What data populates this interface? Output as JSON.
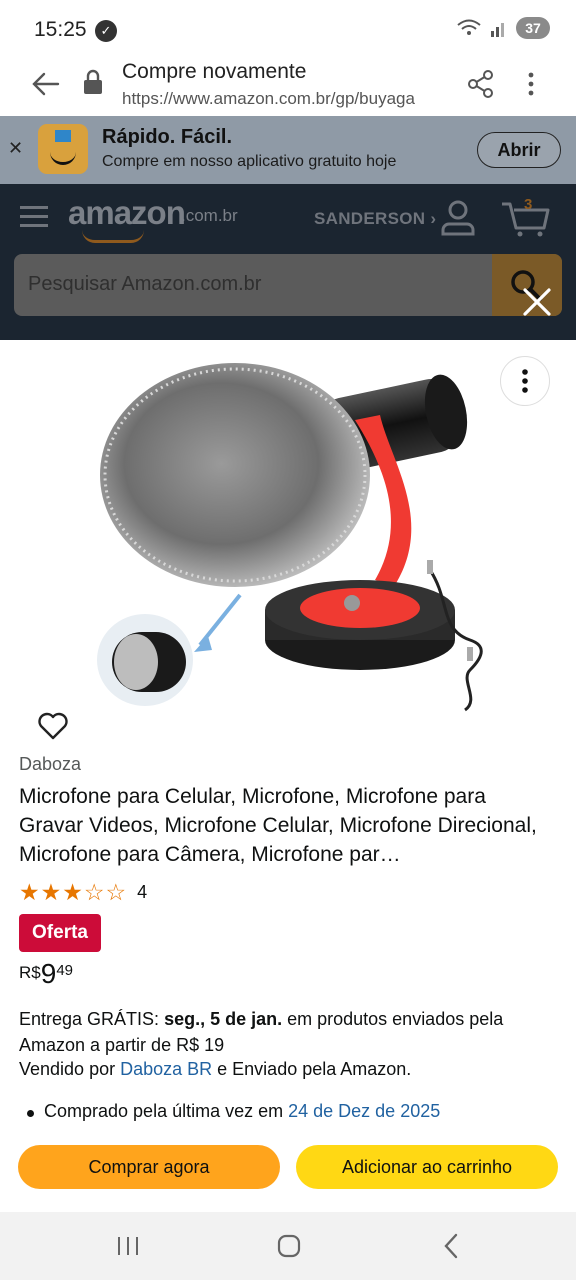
{
  "status": {
    "time": "15:25",
    "battery": "37"
  },
  "browser": {
    "page_title": "Compre novamente",
    "url": "https://www.amazon.com.br/gp/buyaga"
  },
  "app_banner": {
    "title": "Rápido. Fácil.",
    "subtitle": "Compre em nosso aplicativo gratuito hoje",
    "open_label": "Abrir"
  },
  "header": {
    "logo": "amazon",
    "logo_suffix": ".com.br",
    "account_name": "SANDERSON ›",
    "cart_count": "3",
    "search_placeholder": "Pesquisar Amazon.com.br"
  },
  "product": {
    "brand": "Daboza",
    "title": "Microfone para Celular, Microfone, Microfone para Gravar Videos, Microfone Celular, Microfone Direcional, Microfone para Câmera, Microfone par…",
    "rating": 3,
    "rating_max": 5,
    "rating_count": "4",
    "deal_label": "Oferta",
    "price_currency": "R$",
    "price_whole": "9",
    "price_fraction": "49",
    "delivery_prefix": "Entrega GRÁTIS: ",
    "delivery_date": "seg., 5 de jan.",
    "delivery_suffix": " em produtos enviados pela Amazon a partir de R$ 19",
    "sold_by_prefix": "Vendido por ",
    "seller": "Daboza BR",
    "sold_by_suffix": " e Enviado pela Amazon.",
    "last_purchase_prefix": "Comprado pela última vez em ",
    "last_purchase_date": "24 de Dez de 2025"
  },
  "actions": {
    "buy_now": "Comprar agora",
    "add_to_cart": "Adicionar ao carrinho"
  },
  "colors": {
    "overlay": "#3b3b3b",
    "buy_now": "#ffa41c",
    "add_to_cart": "#ffd814",
    "deal": "#cc0c39",
    "link": "#2162a1",
    "stars": "#e77600"
  }
}
